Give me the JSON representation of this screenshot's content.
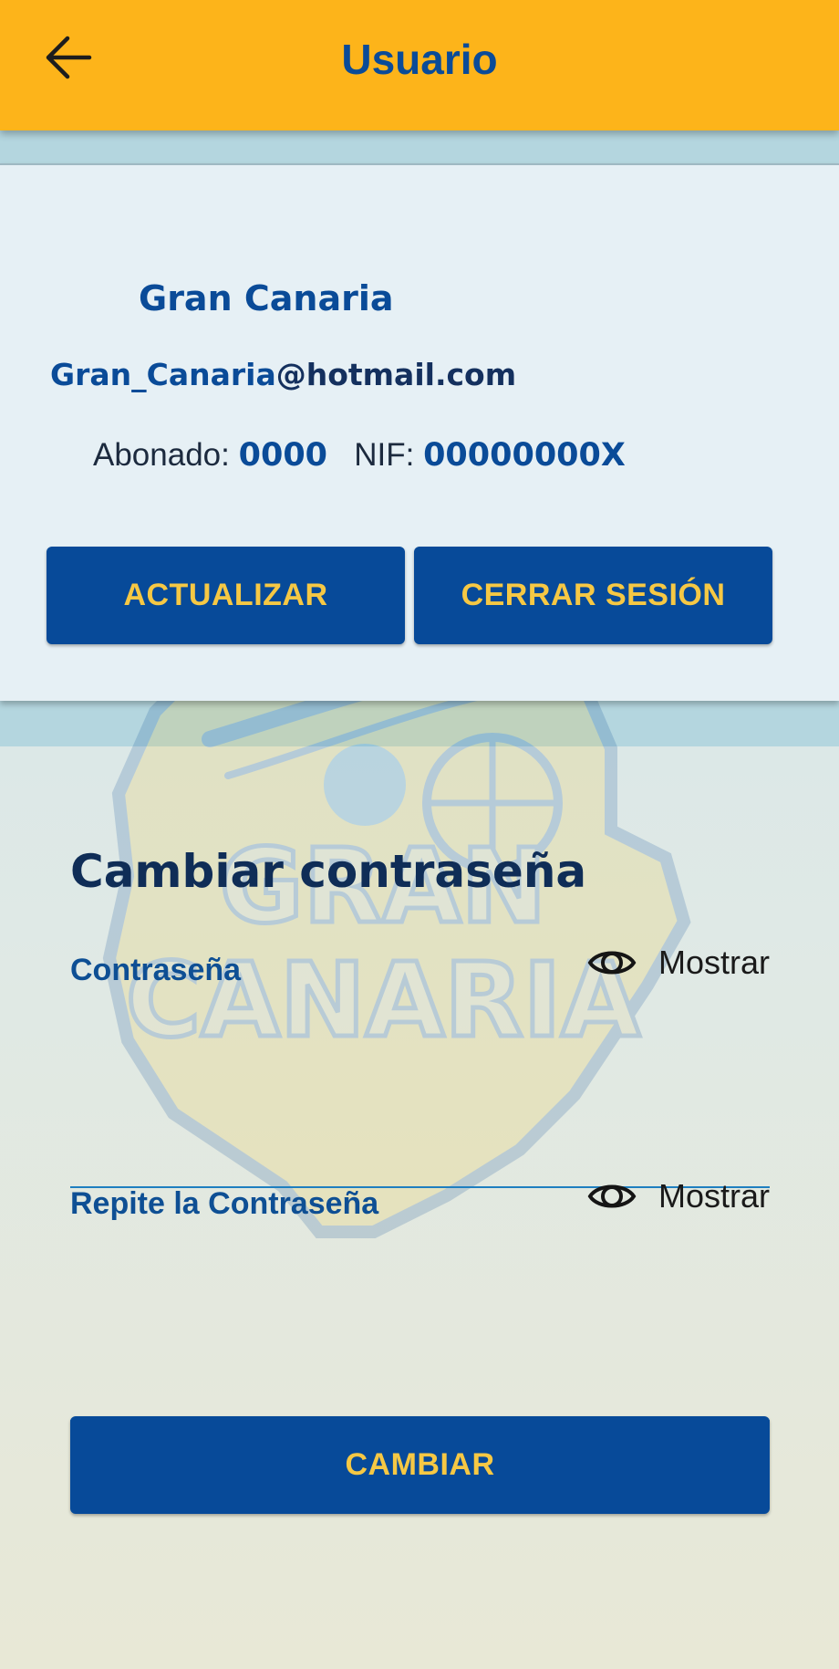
{
  "header": {
    "title": "Usuario",
    "back_icon": "arrow-left-icon"
  },
  "profile": {
    "name": "Gran Canaria",
    "email_local": "Gran_Canaria",
    "email_domain": "@hotmail.com",
    "abonado_label": "Abonado:",
    "abonado_value": "0000",
    "nif_label": "NIF:",
    "nif_value": "00000000X",
    "update_button": "ACTUALIZAR",
    "logout_button": "CERRAR SESIÓN"
  },
  "password": {
    "title": "Cambiar contraseña",
    "field1_label": "Contraseña",
    "field1_value": "",
    "field2_label": "Repite la Contraseña",
    "field2_value": "",
    "show_label": "Mostrar",
    "show_icon": "eye-icon",
    "submit_button": "CAMBIAR"
  },
  "watermark": {
    "line1": "GRAN",
    "line2": "CANARIA"
  },
  "colors": {
    "appbar": "#fdb41a",
    "primary": "#074a99",
    "button_text": "#f6c844",
    "accent_line": "#1f7fc0"
  }
}
